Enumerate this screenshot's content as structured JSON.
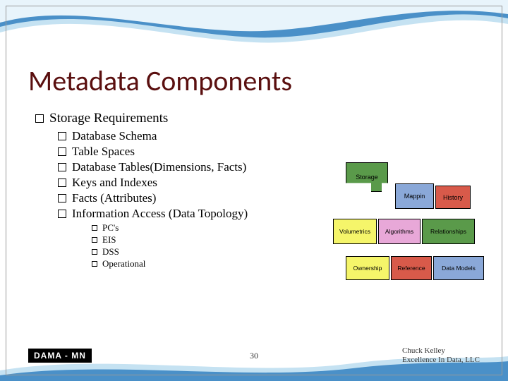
{
  "title": "Metadata Components",
  "section": "Storage Requirements",
  "items": [
    "Database Schema",
    "Table Spaces",
    "Database Tables(Dimensions, Facts)",
    "Keys and Indexes",
    "Facts (Attributes)",
    "Information Access (Data Topology)"
  ],
  "subitems": [
    "PC's",
    "EIS",
    "DSS",
    "Operational"
  ],
  "puzzle": {
    "storage": "Storage",
    "mappin": "Mappin",
    "history": "History",
    "volumetrics": "Volumetrics",
    "algorithms": "Algorithms",
    "relationships": "Relationships",
    "ownership": "Ownership",
    "reference": "Reference",
    "datamodels": "Data Models"
  },
  "footer": {
    "logo": "DAMA - MN",
    "page": "30",
    "author": "Chuck Kelley",
    "org": "Excellence In Data, LLC"
  }
}
